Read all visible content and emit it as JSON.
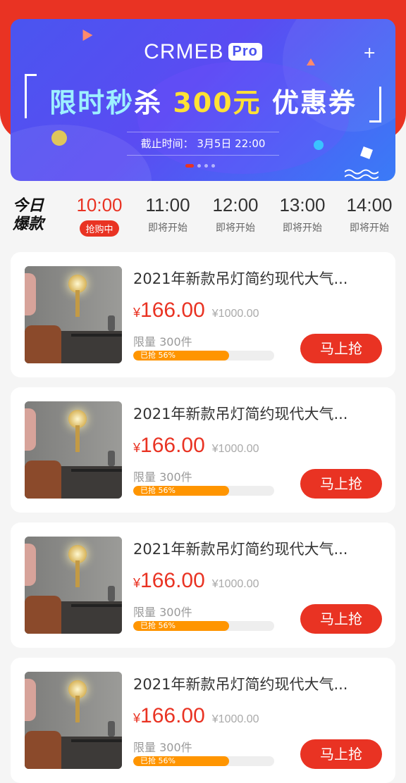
{
  "banner": {
    "logo": "CRMEB",
    "logo_badge": "Pro",
    "title_part1": "限时秒",
    "title_part2": "杀",
    "title_amount": "300元",
    "title_part3": "优惠券",
    "deadline": "截止时间：  3月5日 22:00"
  },
  "today_label_1": "今日",
  "today_label_2": "爆款",
  "time_slots": [
    {
      "time": "10:00",
      "status": "抢购中",
      "active": true
    },
    {
      "time": "11:00",
      "status": "即将开始",
      "active": false
    },
    {
      "time": "12:00",
      "status": "即将开始",
      "active": false
    },
    {
      "time": "13:00",
      "status": "即将开始",
      "active": false
    },
    {
      "time": "14:00",
      "status": "即将开始",
      "active": false
    }
  ],
  "products": [
    {
      "title": "2021年新款吊灯简约现代大气...",
      "price_symbol": "¥",
      "price": "166.00",
      "original_price": "¥1000.00",
      "limit": "限量 300件",
      "progress_text": "已抢 56%",
      "progress": 0.68,
      "button": "马上抢"
    },
    {
      "title": "2021年新款吊灯简约现代大气...",
      "price_symbol": "¥",
      "price": "166.00",
      "original_price": "¥1000.00",
      "limit": "限量 300件",
      "progress_text": "已抢 56%",
      "progress": 0.68,
      "button": "马上抢"
    },
    {
      "title": "2021年新款吊灯简约现代大气...",
      "price_symbol": "¥",
      "price": "166.00",
      "original_price": "¥1000.00",
      "limit": "限量 300件",
      "progress_text": "已抢 56%",
      "progress": 0.68,
      "button": "马上抢"
    },
    {
      "title": "2021年新款吊灯简约现代大气...",
      "price_symbol": "¥",
      "price": "166.00",
      "original_price": "¥1000.00",
      "limit": "限量 300件",
      "progress_text": "已抢 56%",
      "progress": 0.68,
      "button": "马上抢"
    }
  ],
  "colors": {
    "brand_red": "#e93323",
    "progress_orange": "#ff9500",
    "banner_blue": "#4a55f0"
  }
}
